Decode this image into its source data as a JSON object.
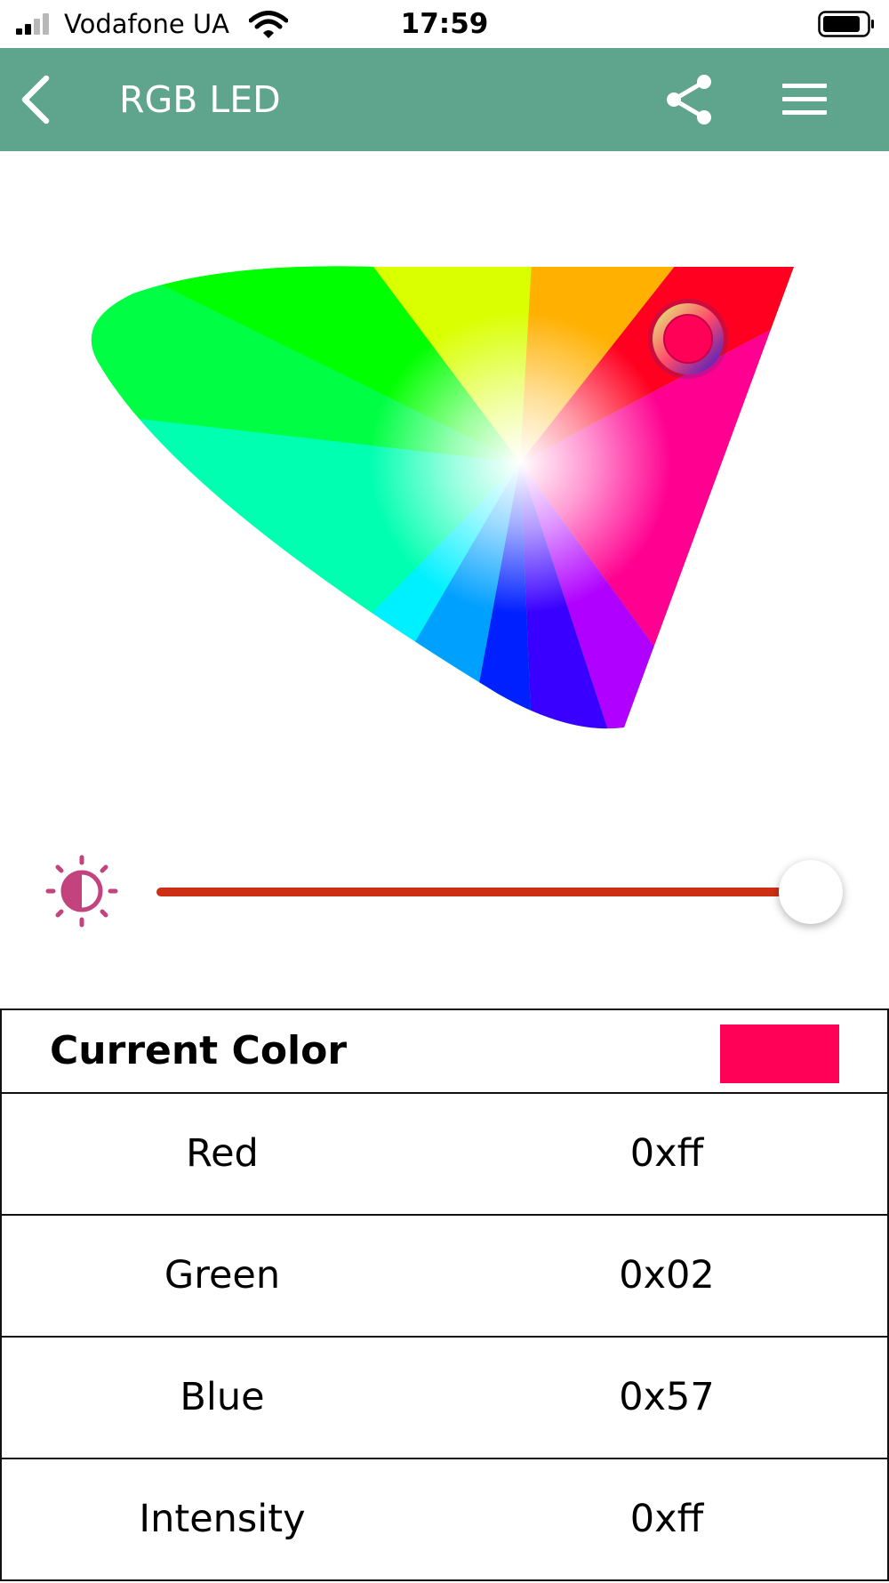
{
  "status_bar": {
    "carrier": "Vodafone UA",
    "time": "17:59",
    "icons": [
      "signal-icon",
      "wifi-icon",
      "battery-icon"
    ]
  },
  "app_bar": {
    "title": "RGB LED",
    "background_color": "#5fa48d",
    "icons": [
      "back-icon",
      "share-icon",
      "menu-icon"
    ]
  },
  "color_picker": {
    "selected_color": "#ff0257"
  },
  "brightness": {
    "icon": "brightness-icon",
    "level_fraction": 1.0,
    "track_color": "#cd2f14"
  },
  "table": {
    "header": "Current Color",
    "swatch_color": "#ff0257",
    "rows": [
      {
        "name": "Red",
        "value": "0xff"
      },
      {
        "name": "Green",
        "value": "0x02"
      },
      {
        "name": "Blue",
        "value": "0x57"
      },
      {
        "name": "Intensity",
        "value": "0xff"
      }
    ]
  }
}
